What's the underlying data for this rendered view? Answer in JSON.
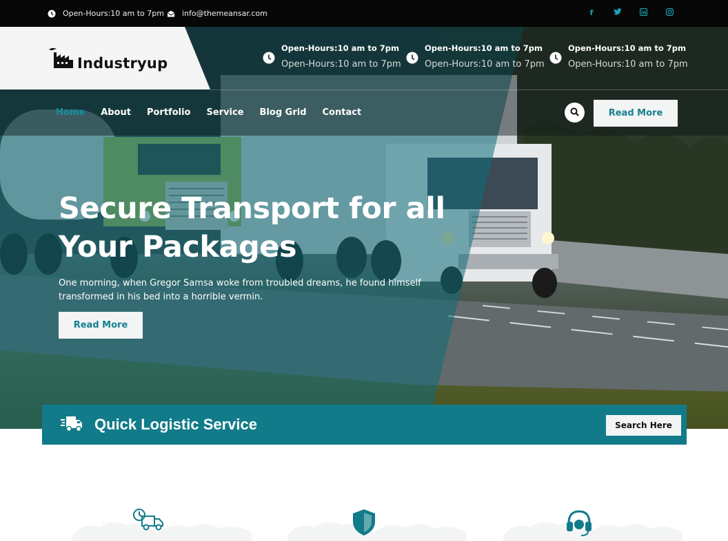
{
  "topbar": {
    "hours": "Open-Hours:10 am to 7pm",
    "email": "info@themeansar.com",
    "social": [
      "facebook-icon",
      "twitter-icon",
      "linkedin-icon",
      "instagram-icon"
    ]
  },
  "brand": {
    "name": "Industryup"
  },
  "header_info": [
    {
      "title": "Open-Hours:10 am to 7pm",
      "subtitle": "Open-Hours:10 am to 7pm"
    },
    {
      "title": "Open-Hours:10 am to 7pm",
      "subtitle": "Open-Hours:10 am to 7pm"
    },
    {
      "title": "Open-Hours:10 am to 7pm",
      "subtitle": "Open-Hours:10 am to 7pm"
    }
  ],
  "nav": {
    "items": [
      "Home",
      "About",
      "Portfolio",
      "Service",
      "Blog Grid",
      "Contact"
    ],
    "active": "Home",
    "cta": "Read More"
  },
  "hero": {
    "title_line1": "Secure Transport for all",
    "title_line2": "Your Packages",
    "text_line1": "One morning, when Gregor Samsa woke from troubled dreams, he found himself",
    "text_line2": "transformed in his bed into a horrible vermin.",
    "button": "Read More"
  },
  "quick": {
    "title": "Quick Logistic Service",
    "button": "Search Here"
  },
  "features": [
    "delivery-truck-clock-icon",
    "shield-icon",
    "headset-icon"
  ],
  "colors": {
    "accent": "#16909f",
    "bar": "#127b89",
    "topbar": "#070707"
  }
}
